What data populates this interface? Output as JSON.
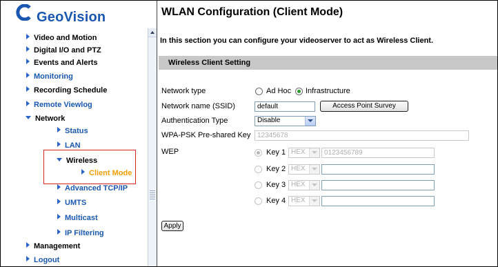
{
  "brand": {
    "name": "GeoVision"
  },
  "sidebar": {
    "items": [
      {
        "label": "Video and Motion"
      },
      {
        "label": "Digital I/O and PTZ"
      },
      {
        "label": "Events and Alerts"
      },
      {
        "label": "Monitoring"
      },
      {
        "label": "Recording Schedule"
      },
      {
        "label": "Remote Viewlog"
      },
      {
        "label": "Network"
      },
      {
        "label": "Status"
      },
      {
        "label": "LAN"
      },
      {
        "label": "Wireless"
      },
      {
        "label": "Client Mode"
      },
      {
        "label": "Advanced TCP/IP"
      },
      {
        "label": "UMTS"
      },
      {
        "label": "Multicast"
      },
      {
        "label": "IP Filtering"
      },
      {
        "label": "Management"
      },
      {
        "label": "Logout"
      }
    ]
  },
  "page": {
    "title": "WLAN Configuration (Client Mode)",
    "intro": "In this section you can configure your videoserver to act as Wireless Client.",
    "section_title": "Wireless Client Setting"
  },
  "form": {
    "network_type_label": "Network type",
    "network_type_options": [
      "Ad Hoc",
      "Infrastructure"
    ],
    "network_type_selected": "Infrastructure",
    "ssid_label": "Network name (SSID)",
    "ssid_value": "default",
    "survey_button": "Access Point Survey",
    "auth_label": "Authentication Type",
    "auth_value": "Disable",
    "wpa_label": "WPA-PSK Pre-shared Key",
    "wpa_value": "12345678",
    "wep_label": "WEP",
    "wep_keys": [
      {
        "label": "Key 1",
        "format": "HEX",
        "value": "0123456789",
        "selected": true
      },
      {
        "label": "Key 2",
        "format": "HEX",
        "value": "",
        "selected": false
      },
      {
        "label": "Key 3",
        "format": "HEX",
        "value": "",
        "selected": false
      },
      {
        "label": "Key 4",
        "format": "HEX",
        "value": "",
        "selected": false
      }
    ],
    "apply_button": "Apply"
  },
  "colors": {
    "nav_blue": "#1a57b0",
    "nav_active": "#f39c00",
    "highlight_border": "#d9231f",
    "section_bg": "#c8c8c8"
  }
}
